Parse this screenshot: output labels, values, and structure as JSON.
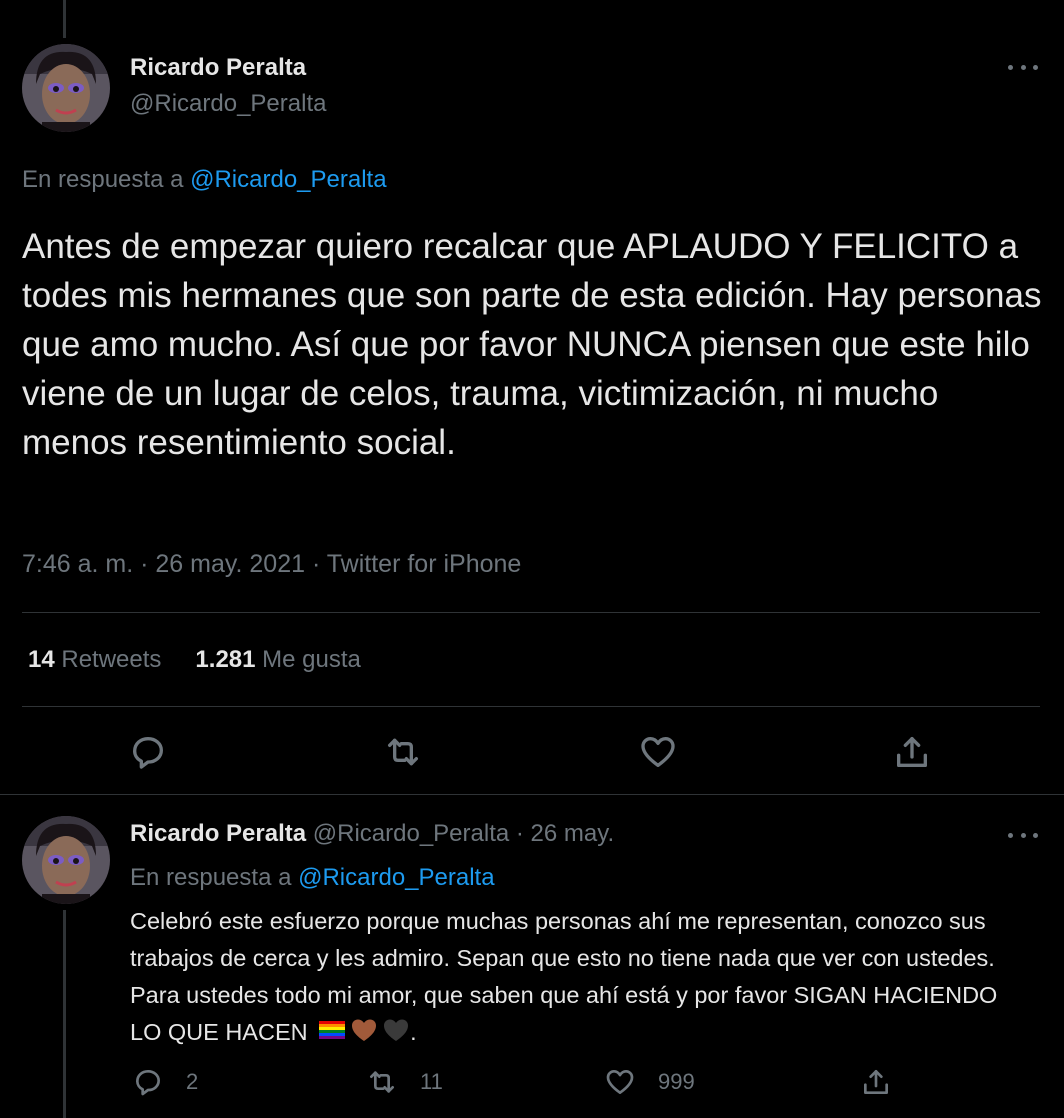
{
  "main_tweet": {
    "name": "Ricardo Peralta",
    "handle": "@Ricardo_Peralta",
    "replying_prefix": "En respuesta a",
    "replying_to": "@Ricardo_Peralta",
    "text": "Antes de empezar quiero recalcar que APLAUDO Y FELICITO a todes mis hermanes que son parte de esta edición. Hay personas que amo mucho. Así que por favor NUNCA piensen que este hilo viene de un lugar de celos, trauma, victimización, ni mucho menos resentimiento social.",
    "meta": "7:46 a. m. · 26 may. 2021 · Twitter for iPhone",
    "retweets_count": "14",
    "retweets_label": "Retweets",
    "likes_count": "1.281",
    "likes_label": "Me gusta"
  },
  "reply_tweet": {
    "name": "Ricardo Peralta",
    "handle": "@Ricardo_Peralta",
    "separator": "·",
    "date": "26 may.",
    "replying_prefix": "En respuesta a",
    "replying_to": "@Ricardo_Peralta",
    "text": "Celebró este esfuerzo porque muchas personas ahí me representan, conozco sus trabajos de cerca y les admiro. Sepan que esto no tiene nada que ver con ustedes. Para ustedes todo mi amor, que saben que ahí está y por favor SIGAN HACIENDO LO QUE HACEN",
    "text_end": ".",
    "reply_count": "2",
    "retweet_count": "11",
    "like_count": "999"
  },
  "icons": {
    "reply": "reply-icon",
    "retweet": "retweet-icon",
    "like": "heart-icon",
    "share": "share-icon",
    "more": "more-icon"
  },
  "colors": {
    "background": "#000000",
    "link": "#1d9bf0",
    "muted": "#6e767d",
    "divider": "#2f3336"
  }
}
